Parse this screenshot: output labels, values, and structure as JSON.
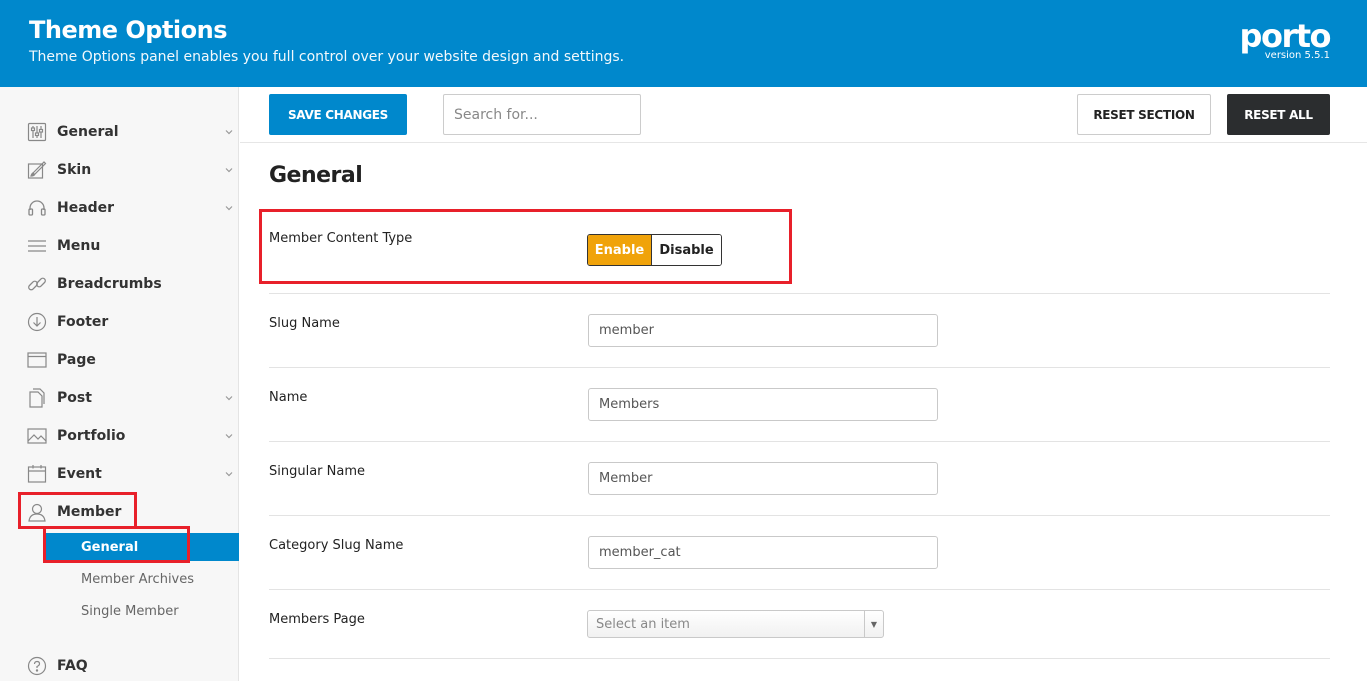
{
  "header": {
    "title": "Theme Options",
    "subtitle": "Theme Options panel enables you full control over your website design and settings.",
    "logo_text": "porto",
    "version": "version 5.5.1"
  },
  "sidebar": {
    "items": [
      {
        "label": "General",
        "icon": "sliders-icon",
        "expandable": true
      },
      {
        "label": "Skin",
        "icon": "brush-icon",
        "expandable": true
      },
      {
        "label": "Header",
        "icon": "headphones-icon",
        "expandable": true
      },
      {
        "label": "Menu",
        "icon": "hamburger-menu-icon",
        "expandable": false
      },
      {
        "label": "Breadcrumbs",
        "icon": "link-icon",
        "expandable": false
      },
      {
        "label": "Footer",
        "icon": "arrow-down-circle-icon",
        "expandable": false
      },
      {
        "label": "Page",
        "icon": "browser-window-icon",
        "expandable": false
      },
      {
        "label": "Post",
        "icon": "documents-icon",
        "expandable": true
      },
      {
        "label": "Portfolio",
        "icon": "image-icon",
        "expandable": true
      },
      {
        "label": "Event",
        "icon": "calendar-icon",
        "expandable": true
      },
      {
        "label": "Member",
        "icon": "user-icon",
        "expandable": true,
        "expanded": true
      },
      {
        "label": "FAQ",
        "icon": "question-circle-icon",
        "expandable": false
      }
    ],
    "member_subitems": [
      {
        "label": "General",
        "active": true
      },
      {
        "label": "Member Archives",
        "active": false
      },
      {
        "label": "Single Member",
        "active": false
      }
    ]
  },
  "toolbar": {
    "save_label": "SAVE CHANGES",
    "search_placeholder": "Search for...",
    "reset_section_label": "RESET SECTION",
    "reset_all_label": "RESET ALL"
  },
  "main": {
    "section_title": "General",
    "member_content_type": {
      "label": "Member Content Type",
      "enable_label": "Enable",
      "disable_label": "Disable",
      "selected": "Enable"
    },
    "fields": [
      {
        "label": "Slug Name",
        "value": "member"
      },
      {
        "label": "Name",
        "value": "Members"
      },
      {
        "label": "Singular Name",
        "value": "Member"
      },
      {
        "label": "Category Slug Name",
        "value": "member_cat"
      }
    ],
    "members_page": {
      "label": "Members Page",
      "placeholder": "Select an item"
    }
  },
  "colors": {
    "primary": "#0088cc",
    "toggle_on": "#f0a30a",
    "dark_button": "#2b2d2f",
    "highlight_box": "#e8202a"
  }
}
